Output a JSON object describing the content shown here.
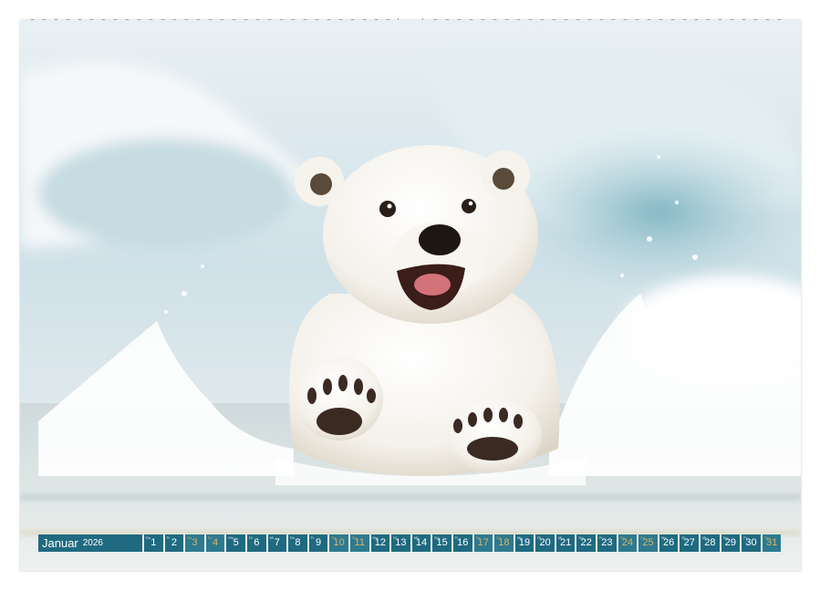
{
  "calendar": {
    "month": "Januar",
    "year": "2026",
    "days": [
      {
        "n": "1",
        "wd": "Do",
        "we": false
      },
      {
        "n": "2",
        "wd": "Fr",
        "we": false
      },
      {
        "n": "3",
        "wd": "Sa",
        "we": true
      },
      {
        "n": "4",
        "wd": "So",
        "we": true
      },
      {
        "n": "5",
        "wd": "Mo",
        "we": false
      },
      {
        "n": "6",
        "wd": "Di",
        "we": false
      },
      {
        "n": "7",
        "wd": "Mi",
        "we": false
      },
      {
        "n": "8",
        "wd": "Do",
        "we": false
      },
      {
        "n": "9",
        "wd": "Fr",
        "we": false
      },
      {
        "n": "10",
        "wd": "Sa",
        "we": true
      },
      {
        "n": "11",
        "wd": "So",
        "we": true
      },
      {
        "n": "12",
        "wd": "Mo",
        "we": false
      },
      {
        "n": "13",
        "wd": "Di",
        "we": false
      },
      {
        "n": "14",
        "wd": "Mi",
        "we": false
      },
      {
        "n": "15",
        "wd": "Do",
        "we": false
      },
      {
        "n": "16",
        "wd": "Fr",
        "we": false
      },
      {
        "n": "17",
        "wd": "Sa",
        "we": true
      },
      {
        "n": "18",
        "wd": "So",
        "we": true
      },
      {
        "n": "19",
        "wd": "Mo",
        "we": false
      },
      {
        "n": "20",
        "wd": "Di",
        "we": false
      },
      {
        "n": "21",
        "wd": "Mi",
        "we": false
      },
      {
        "n": "22",
        "wd": "Do",
        "we": false
      },
      {
        "n": "23",
        "wd": "Fr",
        "we": false
      },
      {
        "n": "24",
        "wd": "Sa",
        "we": true
      },
      {
        "n": "25",
        "wd": "So",
        "we": true
      },
      {
        "n": "26",
        "wd": "Mo",
        "we": false
      },
      {
        "n": "27",
        "wd": "Di",
        "we": false
      },
      {
        "n": "28",
        "wd": "Mi",
        "we": false
      },
      {
        "n": "29",
        "wd": "Do",
        "we": false
      },
      {
        "n": "30",
        "wd": "Fr",
        "we": false
      },
      {
        "n": "31",
        "wd": "Sa",
        "we": true
      }
    ]
  },
  "colors": {
    "strip": "#1f6a80",
    "weekend_text": "#d9b36a"
  }
}
